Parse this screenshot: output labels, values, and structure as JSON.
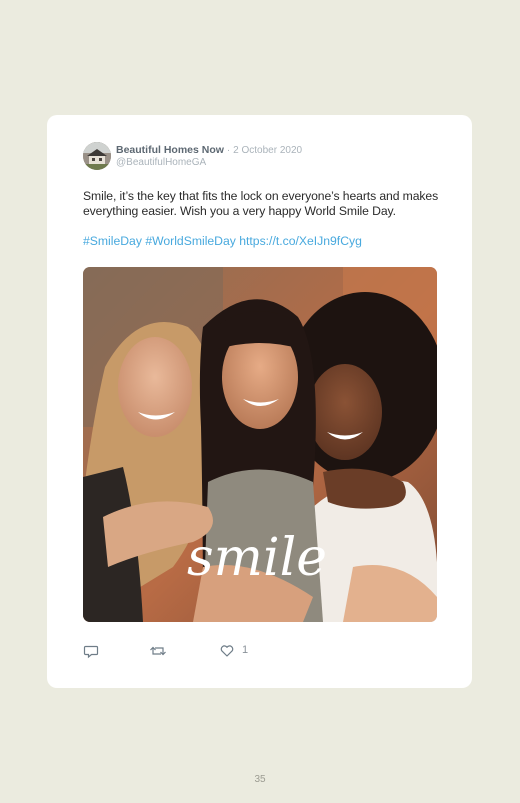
{
  "tweet": {
    "author_name": "Beautiful Homes Now",
    "separator": "·",
    "date": "2 October 2020",
    "handle": "@BeautifulHomeGA",
    "text": "Smile, it’s the key that fits the lock on everyone’s hearts and makes everything easier. Wish you a very happy World Smile Day.",
    "hashtag_1": "#SmileDay",
    "hashtag_2": "#WorldSmileDay",
    "link": "https://t.co/XeIJn9fCyg",
    "image_overlay_text": "smile",
    "like_count": "1"
  },
  "icons": {
    "reply": "reply-icon",
    "retweet": "retweet-icon",
    "like": "heart-icon"
  },
  "colors": {
    "page_background": "#ebebdf",
    "card_background": "#ffffff",
    "link": "#48a9de"
  },
  "page": {
    "number": "35"
  }
}
